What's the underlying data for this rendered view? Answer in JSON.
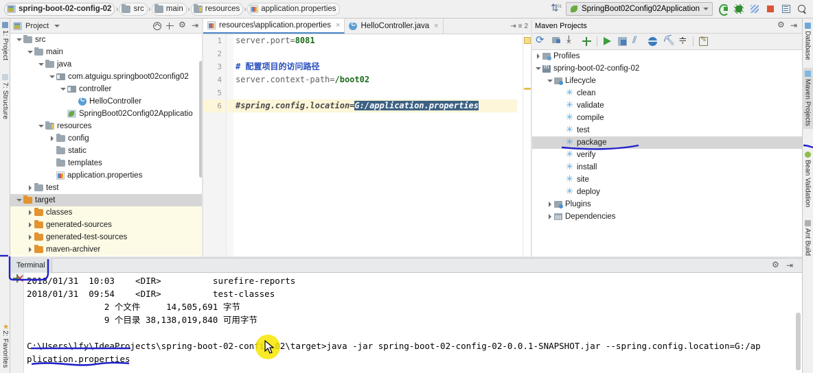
{
  "breadcrumb": {
    "items": [
      {
        "label": "spring-boot-02-config-02",
        "icon": "module-icon"
      },
      {
        "label": "src",
        "icon": "folder-icon"
      },
      {
        "label": "main",
        "icon": "folder-icon"
      },
      {
        "label": "resources",
        "icon": "resources-folder-icon"
      },
      {
        "label": "application.properties",
        "icon": "properties-file-icon"
      }
    ]
  },
  "toolbar": {
    "sort_icon": "sort-alphabetically-icon",
    "run_config": "SpringBoot02Config02Application",
    "buttons": [
      {
        "name": "run-button",
        "icon": "run-icon"
      },
      {
        "name": "debug-button",
        "icon": "debug-icon"
      },
      {
        "name": "coverage-button",
        "icon": "run-with-coverage-icon"
      },
      {
        "name": "stop-button",
        "icon": "stop-icon"
      },
      {
        "name": "layout-button",
        "icon": "layout-icon"
      },
      {
        "name": "search-everywhere-button",
        "icon": "search-icon"
      }
    ]
  },
  "left_strip": {
    "tabs": [
      {
        "label": "1: Project",
        "icon": "project-icon"
      },
      {
        "label": "7: Structure",
        "icon": "structure-icon"
      },
      {
        "label": "2: Favorites",
        "icon": "favorites-star-icon"
      }
    ]
  },
  "right_strip": {
    "tabs": [
      {
        "label": "Database",
        "icon": "database-icon"
      },
      {
        "label": "Maven Projects",
        "icon": "maven-icon"
      },
      {
        "label": "Bean Validation",
        "icon": "bean-validation-icon"
      },
      {
        "label": "Ant Build",
        "icon": "ant-icon"
      }
    ]
  },
  "project_panel": {
    "title": "Project",
    "tree": [
      {
        "label": "src",
        "depth": 1,
        "arrow": "down",
        "icon": "folder",
        "hl": false
      },
      {
        "label": "main",
        "depth": 2,
        "arrow": "down",
        "icon": "folder",
        "hl": false
      },
      {
        "label": "java",
        "depth": 3,
        "arrow": "down",
        "icon": "folder",
        "hl": false
      },
      {
        "label": "com.atguigu.springboot02config02",
        "depth": 4,
        "arrow": "down",
        "icon": "pkg",
        "hl": false
      },
      {
        "label": "controller",
        "depth": 5,
        "arrow": "down",
        "icon": "pkg",
        "hl": false
      },
      {
        "label": "HelloController",
        "depth": 6,
        "arrow": "none",
        "icon": "java",
        "hl": false
      },
      {
        "label": "SpringBoot02Config02Applicatio",
        "depth": 5,
        "arrow": "none",
        "icon": "spring",
        "hl": false
      },
      {
        "label": "resources",
        "depth": 3,
        "arrow": "down",
        "icon": "res",
        "hl": false
      },
      {
        "label": "config",
        "depth": 4,
        "arrow": "right",
        "icon": "folder",
        "hl": false
      },
      {
        "label": "static",
        "depth": 4,
        "arrow": "none",
        "icon": "folder",
        "hl": false
      },
      {
        "label": "templates",
        "depth": 4,
        "arrow": "none",
        "icon": "folder",
        "hl": false
      },
      {
        "label": "application.properties",
        "depth": 4,
        "arrow": "none",
        "icon": "props",
        "hl": false
      },
      {
        "label": "test",
        "depth": 2,
        "arrow": "right",
        "icon": "folder",
        "hl": false
      },
      {
        "label": "target",
        "depth": 1,
        "arrow": "down",
        "icon": "folder-orange",
        "hl": true,
        "sel": true
      },
      {
        "label": "classes",
        "depth": 2,
        "arrow": "right",
        "icon": "folder-orange",
        "hl": true
      },
      {
        "label": "generated-sources",
        "depth": 2,
        "arrow": "right",
        "icon": "folder-orange",
        "hl": true
      },
      {
        "label": "generated-test-sources",
        "depth": 2,
        "arrow": "right",
        "icon": "folder-orange",
        "hl": true
      },
      {
        "label": "maven-archiver",
        "depth": 2,
        "arrow": "right",
        "icon": "folder-orange",
        "hl": true
      }
    ]
  },
  "editor": {
    "tabs": [
      {
        "label": "resources\\application.properties",
        "icon": "properties-file-icon",
        "active": true
      },
      {
        "label": "HelloController.java",
        "icon": "java-class-icon",
        "active": false
      }
    ],
    "tab_counter": "2",
    "line_numbers": [
      "1",
      "2",
      "3",
      "4",
      "5",
      "6"
    ],
    "current_line": 6,
    "lines": [
      {
        "n": 1,
        "segments": [
          {
            "t": "server.port=",
            "c": "key"
          },
          {
            "t": "8081",
            "c": "val"
          }
        ]
      },
      {
        "n": 2,
        "segments": []
      },
      {
        "n": 3,
        "segments": [
          {
            "t": "# 配置项目的访问路径",
            "c": "cmt"
          }
        ]
      },
      {
        "n": 4,
        "segments": [
          {
            "t": "server.context-path=",
            "c": "key"
          },
          {
            "t": "/boot02",
            "c": "val"
          }
        ]
      },
      {
        "n": 5,
        "segments": []
      },
      {
        "n": 6,
        "segments": [
          {
            "t": "#spring.config.location=",
            "c": "dis"
          },
          {
            "t": "G:/application.properties",
            "c": "selsp"
          }
        ]
      }
    ]
  },
  "maven_panel": {
    "title": "Maven Projects",
    "toolbar_icons": [
      "reimport-icon",
      "generate-sources-icon",
      "download-sources-icon",
      "add-maven-project-icon",
      "run-maven-build-icon",
      "execute-goal-icon",
      "toggle-skip-tests-icon",
      "toggle-offline-icon",
      "show-dependencies-icon",
      "collapse-all-icon",
      "maven-settings-icon"
    ],
    "tree": [
      {
        "label": "Profiles",
        "depth": 1,
        "arrow": "right",
        "icon": "profiles"
      },
      {
        "label": "spring-boot-02-config-02",
        "depth": 1,
        "arrow": "down",
        "icon": "mvnproj"
      },
      {
        "label": "Lifecycle",
        "depth": 2,
        "arrow": "down",
        "icon": "lifecycle"
      },
      {
        "label": "clean",
        "depth": 3,
        "arrow": "none",
        "icon": "goal"
      },
      {
        "label": "validate",
        "depth": 3,
        "arrow": "none",
        "icon": "goal"
      },
      {
        "label": "compile",
        "depth": 3,
        "arrow": "none",
        "icon": "goal"
      },
      {
        "label": "test",
        "depth": 3,
        "arrow": "none",
        "icon": "goal"
      },
      {
        "label": "package",
        "depth": 3,
        "arrow": "none",
        "icon": "goal",
        "sel": true
      },
      {
        "label": "verify",
        "depth": 3,
        "arrow": "none",
        "icon": "goal"
      },
      {
        "label": "install",
        "depth": 3,
        "arrow": "none",
        "icon": "goal"
      },
      {
        "label": "site",
        "depth": 3,
        "arrow": "none",
        "icon": "goal"
      },
      {
        "label": "deploy",
        "depth": 3,
        "arrow": "none",
        "icon": "goal"
      },
      {
        "label": "Plugins",
        "depth": 2,
        "arrow": "right",
        "icon": "plugins"
      },
      {
        "label": "Dependencies",
        "depth": 2,
        "arrow": "right",
        "icon": "deps"
      }
    ]
  },
  "terminal": {
    "tab_label": "Terminal",
    "new_session_icon": "add-session-icon",
    "close_session_icon": "close-session-icon",
    "settings_icon": "gear-icon",
    "hide_icon": "hide-icon",
    "lines": [
      "2018/01/31  10:03    <DIR>          surefire-reports",
      "2018/01/31  09:54    <DIR>          test-classes",
      "               2 个文件     14,505,691 字节",
      "               9 个目录 38,138,019,840 可用字节",
      "",
      "C:\\Users\\lfy\\IdeaProjects\\spring-boot-02-config-02\\target>java -jar spring-boot-02-config-02-0.0.1-SNAPSHOT.jar --spring.config.location=G:/ap",
      "plication.properties"
    ]
  },
  "annotations": {
    "ink_color": "#2222cc",
    "highlight_color": "#f7e600",
    "marks": [
      {
        "name": "underline-package"
      },
      {
        "name": "box-terminal-tab"
      },
      {
        "name": "underline-maven-archiver"
      },
      {
        "name": "line-right-strip"
      },
      {
        "name": "underline-terminal-path"
      },
      {
        "name": "underline-properties-wave"
      }
    ]
  }
}
